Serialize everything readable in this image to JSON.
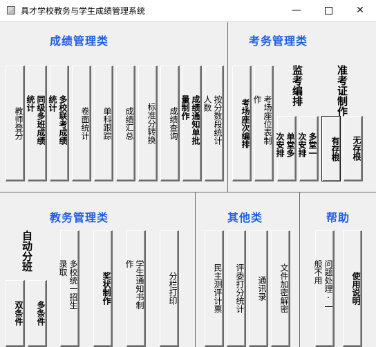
{
  "window": {
    "title": "具才学校教务与学生成绩管理系统",
    "min_icon": "—",
    "close_icon": "✕"
  },
  "sections": {
    "grades": "成绩管理类",
    "exams": "考务管理类",
    "academic": "教务管理类",
    "other": "其他类",
    "help": "帮助"
  },
  "grades_buttons": [
    {
      "label": "教师登分",
      "bold": false
    },
    {
      "label": "同级多班成绩统计",
      "bold": true
    },
    {
      "label": "多校联考成绩统计",
      "bold": true
    },
    {
      "label": "卷面统计",
      "bold": false
    },
    {
      "label": "单科跟踪",
      "bold": false
    },
    {
      "label": "成绩汇总",
      "bold": false
    },
    {
      "label": "标准分转换",
      "bold": false
    },
    {
      "label": "成绩查询",
      "bold": false
    },
    {
      "label": "成绩通知单批量制作",
      "bold": true
    },
    {
      "label": "按分数段统计人数",
      "bold": false
    }
  ],
  "exam_buttons": [
    {
      "label": "考场座次编排",
      "bold": true
    },
    {
      "label": "考场座位表制作",
      "bold": false
    }
  ],
  "proctor_label": "监考编排",
  "proctor_buttons": [
    {
      "label": "单堂多次安排",
      "bold": true
    },
    {
      "label": "多堂一次安排",
      "bold": true
    }
  ],
  "ticket_label": "准考证制作",
  "ticket_buttons": [
    {
      "label": "有存根",
      "bold": true
    },
    {
      "label": "无存根",
      "bold": true
    }
  ],
  "auto_class_label": "自动分班",
  "auto_class_buttons": [
    {
      "label": "双条件",
      "bold": true
    },
    {
      "label": "多条件",
      "bold": true
    }
  ],
  "academic_buttons": [
    {
      "label": "多校统一招生录取",
      "bold": false
    },
    {
      "label": "奖状制作",
      "bold": true
    },
    {
      "label": "学生通知书制作",
      "bold": false
    },
    {
      "label": "分栏打印",
      "bold": false
    }
  ],
  "other_buttons": [
    {
      "label": "民主测评计票",
      "bold": false
    },
    {
      "label": "评委打分统计",
      "bold": false
    },
    {
      "label": "通讯录",
      "bold": false
    },
    {
      "label": "文件加密解密",
      "bold": false
    }
  ],
  "help_buttons": [
    {
      "label": "问题处理·一般不用",
      "bold": false
    },
    {
      "label": "使用说明",
      "bold": true
    }
  ]
}
